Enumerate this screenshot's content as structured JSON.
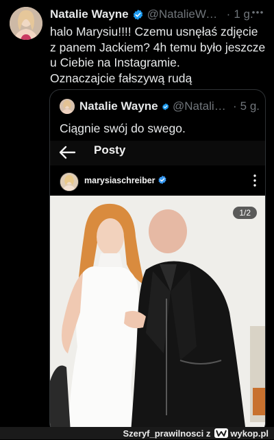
{
  "tweet": {
    "author_name": "Natalie Wayne",
    "handle": "@NatalieWayne",
    "time": "1 g.",
    "text_lines": [
      "halo Marysiu!!!! Czemu usnęłaś zdjęcie",
      "z panem Jackiem? 4h temu było jeszcze",
      "u Ciebie na Instagramie.",
      "Oznaczajcie fałszywą rudą"
    ]
  },
  "quote": {
    "author_name": "Natalie Wayne",
    "handle": "@NatalieWayne",
    "time": "5 g.",
    "text": "Ciągnie swój do swego."
  },
  "instagram": {
    "title": "Posty",
    "username": "marysiaschreiber",
    "pager": "1/2"
  },
  "watermark": {
    "user": "Szeryf_prawilnosci z",
    "site": "wykop.pl"
  },
  "colors": {
    "background": "#000000",
    "verified": "#1d9bf0",
    "muted": "#71767b"
  },
  "icons": [
    "verified-badge-icon",
    "more-icon",
    "back-arrow-icon",
    "vertical-dots-icon"
  ]
}
